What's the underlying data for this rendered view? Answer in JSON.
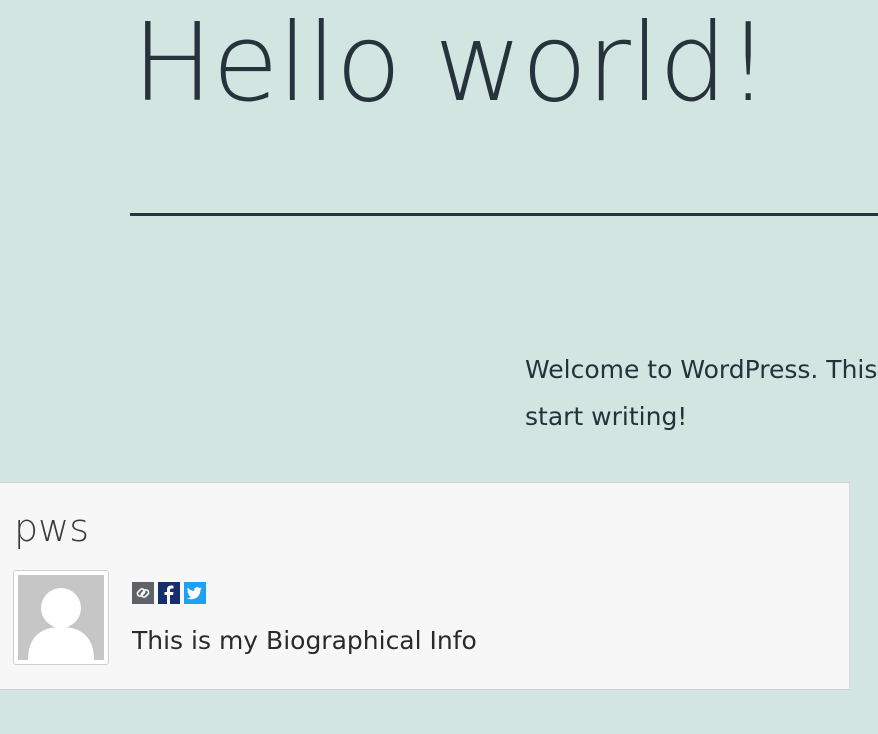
{
  "post": {
    "title": "Hello world!",
    "content": [
      "Welcome to WordPress. This",
      "start writing!"
    ]
  },
  "author_box": {
    "name": "pws",
    "bio": "This is my Biographical Info",
    "social_links": [
      {
        "icon": "link-icon",
        "color": "#5f6368"
      },
      {
        "icon": "facebook-icon",
        "color": "#162e6b"
      },
      {
        "icon": "twitter-icon",
        "color": "#1da1f2"
      }
    ]
  },
  "colors": {
    "page_background": "#d3e5e0",
    "text": "#26333d",
    "author_box_background": "#f7f7f7",
    "avatar_placeholder": "#c6c6c6"
  }
}
